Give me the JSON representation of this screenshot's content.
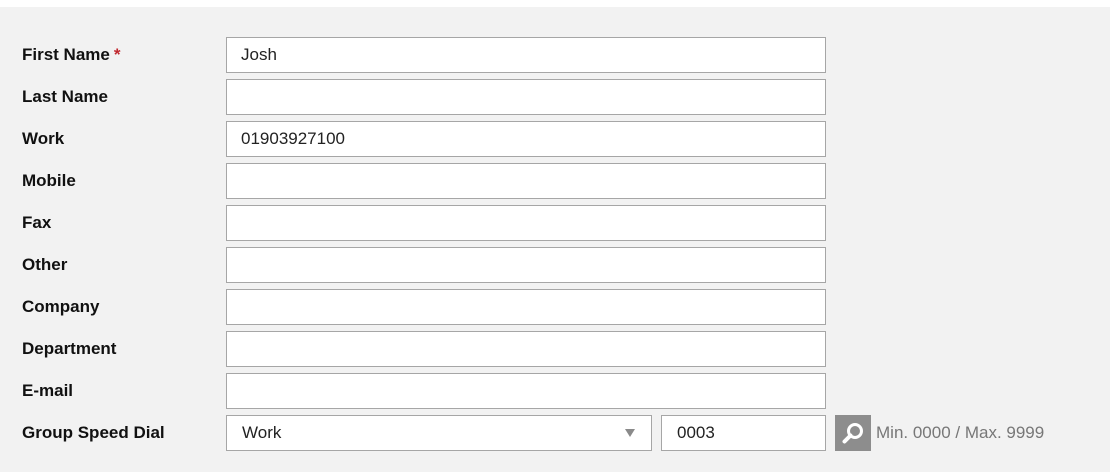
{
  "form": {
    "fields": [
      {
        "label": "First Name",
        "required_mark": "*",
        "value": "Josh"
      },
      {
        "label": "Last Name",
        "value": ""
      },
      {
        "label": "Work",
        "value": "01903927100"
      },
      {
        "label": "Mobile",
        "value": ""
      },
      {
        "label": "Fax",
        "value": ""
      },
      {
        "label": "Other",
        "value": ""
      },
      {
        "label": "Company",
        "value": ""
      },
      {
        "label": "Department",
        "value": ""
      },
      {
        "label": "E-mail",
        "value": ""
      }
    ],
    "speed_dial": {
      "label": "Group Speed Dial",
      "type_selected": "Work",
      "number": "0003",
      "search_icon": "search-icon",
      "range_hint": "Min. 0000 / Max. 9999"
    }
  },
  "colors": {
    "panel_background": "#f2f2f2",
    "required": "#c0272d",
    "input_border": "#a6a6a6",
    "search_button": "#8d8d8d",
    "hint_text": "#777777"
  }
}
